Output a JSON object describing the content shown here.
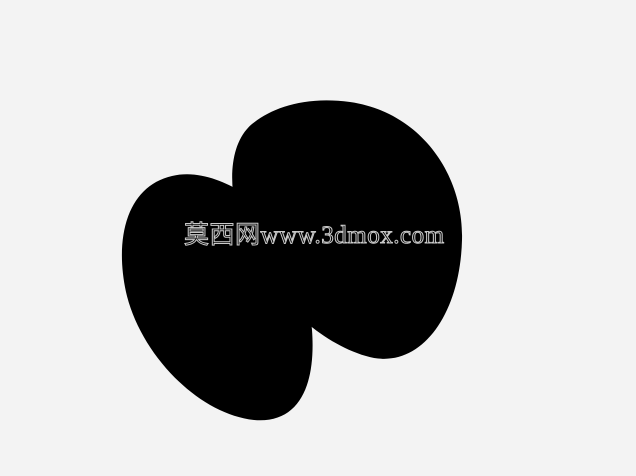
{
  "background_color": "#f3f3f3",
  "shape_color": "#000000",
  "watermark": {
    "text": "莫西网www.3dmox.com",
    "color": "#c9c9c9"
  }
}
